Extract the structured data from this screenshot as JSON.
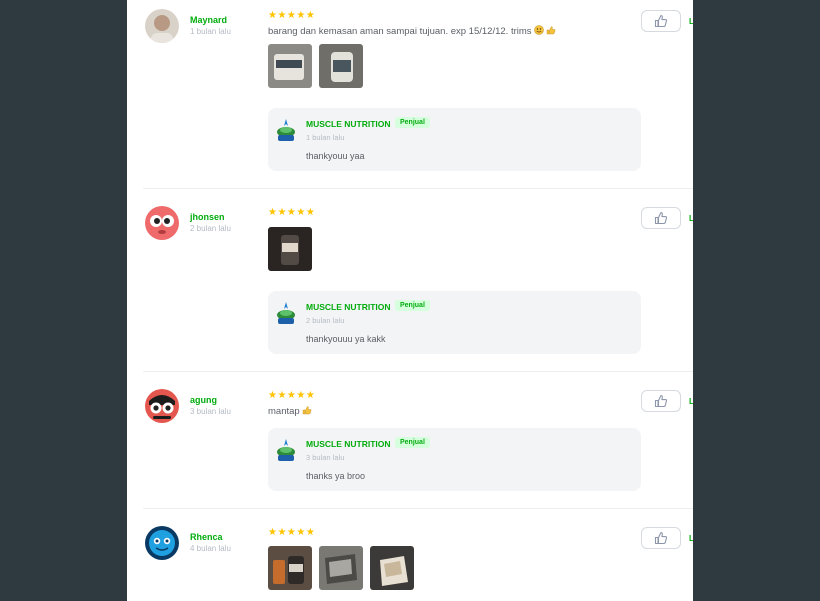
{
  "reviews": [
    {
      "name": "Maynard",
      "time": "1 bulan lalu",
      "stars": "★★★★★",
      "text": "barang dan kemasan aman sampai tujuan. exp 15/12/12. trims",
      "more_label": "L",
      "reply": {
        "seller": "MUSCLE NUTRITION",
        "badge": "Penjual",
        "time": "1 bulan lalu",
        "text": "thankyouu yaa"
      }
    },
    {
      "name": "jhonsen",
      "time": "2 bulan lalu",
      "stars": "★★★★★",
      "more_label": "L",
      "reply": {
        "seller": "MUSCLE NUTRITION",
        "badge": "Penjual",
        "time": "2 bulan lalu",
        "text": "thankyouuu ya kakk"
      }
    },
    {
      "name": "agung",
      "time": "3 bulan lalu",
      "stars": "★★★★★",
      "text": "mantap",
      "more_label": "L",
      "reply": {
        "seller": "MUSCLE NUTRITION",
        "badge": "Penjual",
        "time": "3 bulan lalu",
        "text": "thanks ya broo"
      }
    },
    {
      "name": "Rhenca",
      "time": "4 bulan lalu",
      "stars": "★★★★★",
      "more_label": "L"
    }
  ],
  "colors": {
    "accent": "#03ac0e",
    "star": "#ffc400",
    "backdrop": "#2e3a3f"
  }
}
